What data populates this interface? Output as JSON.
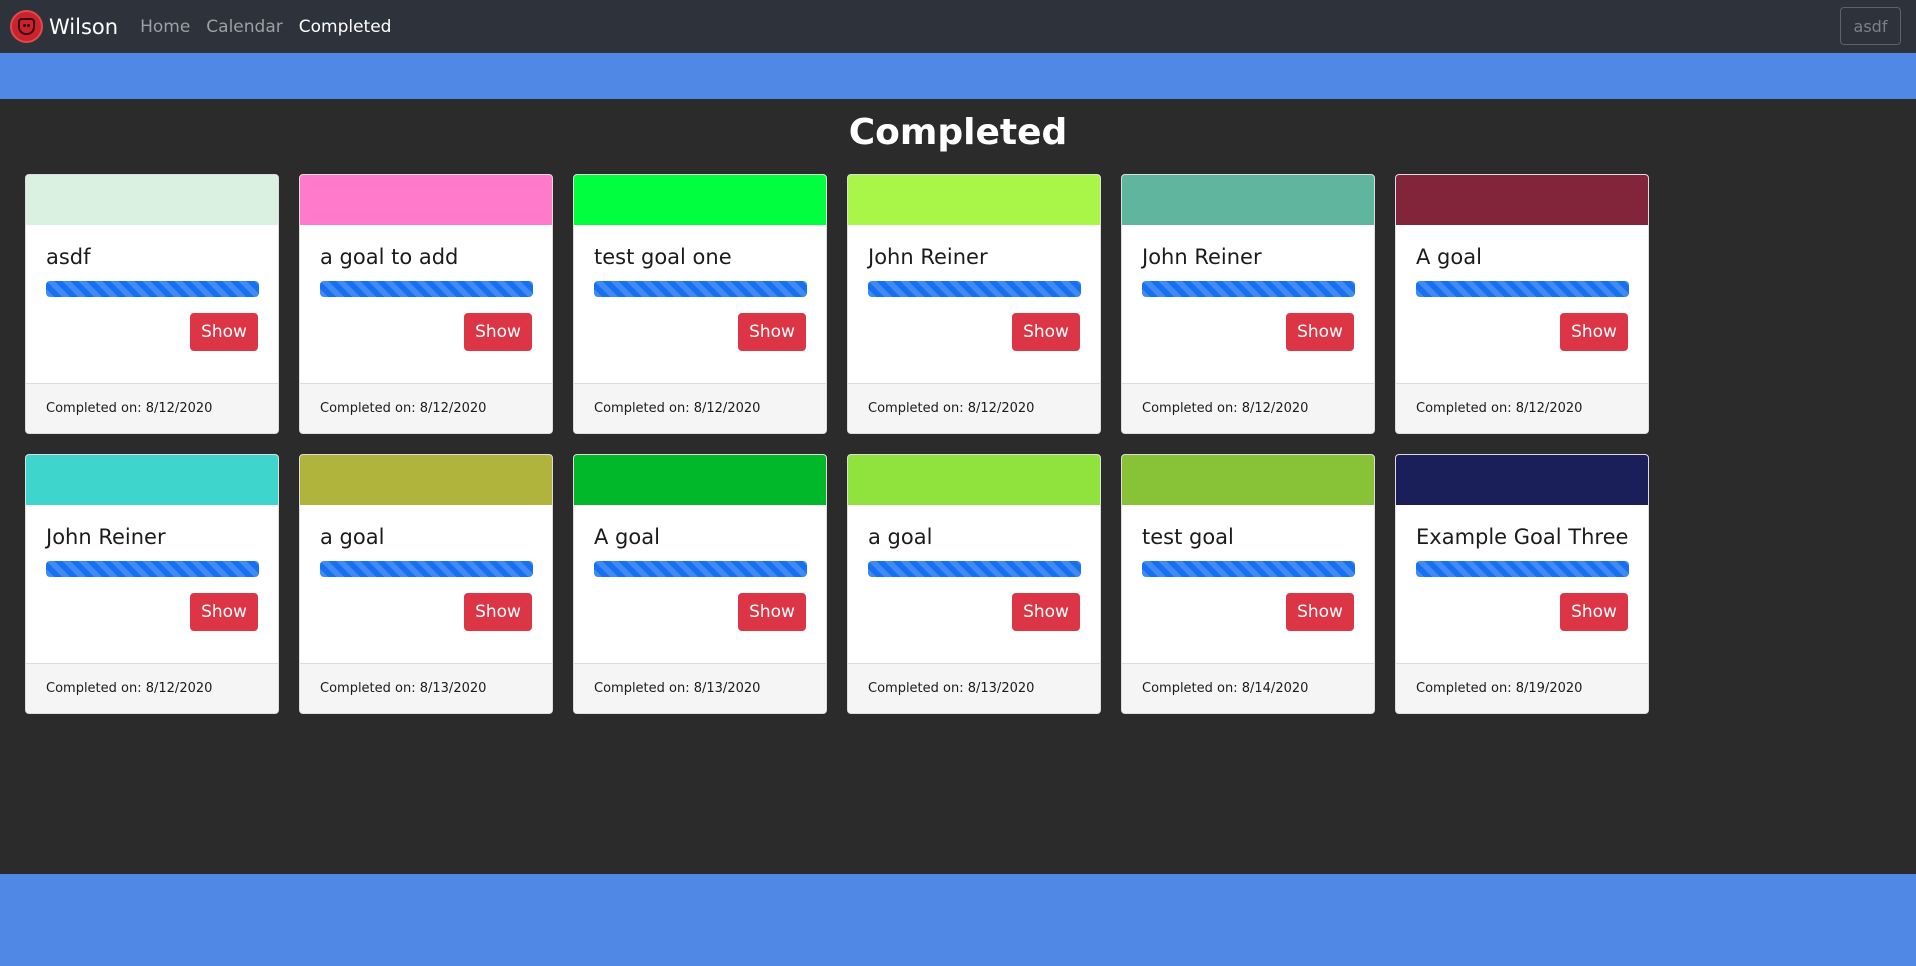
{
  "navbar": {
    "brand": "Wilson",
    "links": [
      {
        "label": "Home",
        "active": false
      },
      {
        "label": "Calendar",
        "active": false
      },
      {
        "label": "Completed",
        "active": true
      }
    ],
    "user": "asdf"
  },
  "page": {
    "title": "Completed"
  },
  "colors": {
    "accent_band": "#4f89e5",
    "navbar_bg": "#2e323b",
    "page_bg": "#2b2b2b",
    "show_button": "#dc3545",
    "progress": "#1770ef"
  },
  "cards": [
    {
      "title": "asdf",
      "color": "#daf0e1",
      "progress": 1.0,
      "button": "Show",
      "footer": "Completed on: 8/12/2020"
    },
    {
      "title": "a goal to add",
      "color": "#ff7acb",
      "progress": 1.0,
      "button": "Show",
      "footer": "Completed on: 8/12/2020"
    },
    {
      "title": "test goal one",
      "color": "#00ff3f",
      "progress": 1.0,
      "button": "Show",
      "footer": "Completed on: 8/12/2020"
    },
    {
      "title": "John Reiner",
      "color": "#aaf648",
      "progress": 1.0,
      "button": "Show",
      "footer": "Completed on: 8/12/2020"
    },
    {
      "title": "John Reiner",
      "color": "#5fb59e",
      "progress": 1.0,
      "button": "Show",
      "footer": "Completed on: 8/12/2020"
    },
    {
      "title": "A goal",
      "color": "#82243a",
      "progress": 1.0,
      "button": "Show",
      "footer": "Completed on: 8/12/2020"
    },
    {
      "title": "John Reiner",
      "color": "#3ed6cc",
      "progress": 1.0,
      "button": "Show",
      "footer": "Completed on: 8/12/2020"
    },
    {
      "title": "a goal",
      "color": "#b0b43c",
      "progress": 1.0,
      "button": "Show",
      "footer": "Completed on: 8/13/2020"
    },
    {
      "title": "A goal",
      "color": "#00b82a",
      "progress": 1.0,
      "button": "Show",
      "footer": "Completed on: 8/13/2020"
    },
    {
      "title": "a goal",
      "color": "#8fe33c",
      "progress": 1.0,
      "button": "Show",
      "footer": "Completed on: 8/13/2020"
    },
    {
      "title": "test goal",
      "color": "#88c337",
      "progress": 1.0,
      "button": "Show",
      "footer": "Completed on: 8/14/2020"
    },
    {
      "title": "Example Goal Three",
      "color": "#1a1f5a",
      "progress": 1.0,
      "button": "Show",
      "footer": "Completed on: 8/19/2020"
    }
  ]
}
